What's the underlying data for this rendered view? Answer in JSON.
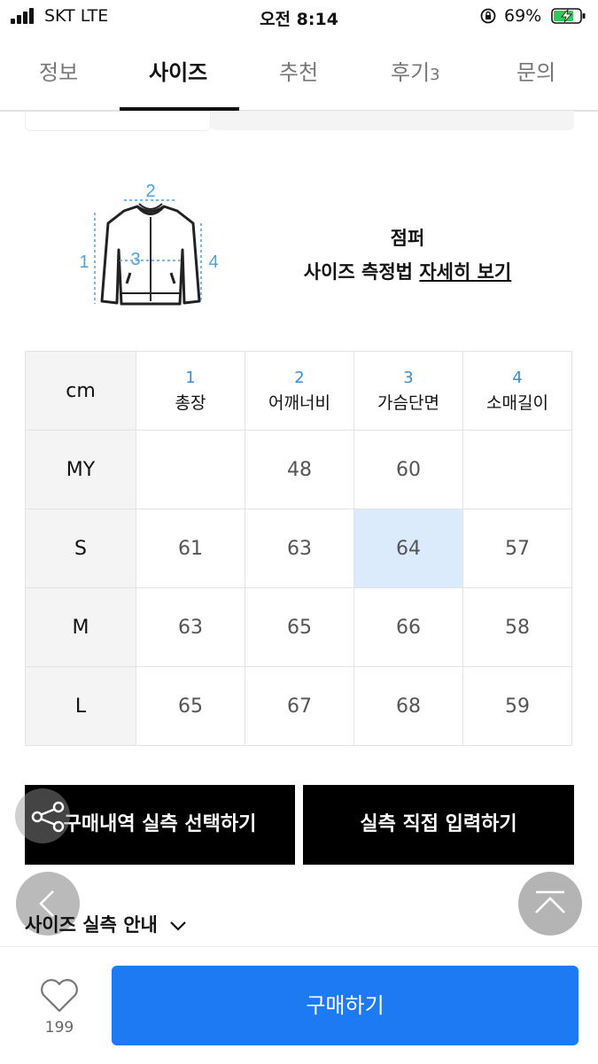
{
  "status_bar": {
    "carrier": "SKT   LTE",
    "time": "오전 8:14",
    "battery": "69%"
  },
  "tabs": [
    {
      "label": "정보"
    },
    {
      "label": "사이즈",
      "active": true
    },
    {
      "label": "추천"
    },
    {
      "label": "후기",
      "count": "3"
    },
    {
      "label": "문의"
    }
  ],
  "size_guide": {
    "icon": "jacket-measurement-icon",
    "measure_labels": [
      "1",
      "2",
      "3",
      "4"
    ],
    "category": "점퍼",
    "method_prefix": "사이즈 측정법 ",
    "method_link": "자세히 보기"
  },
  "size_table": {
    "unit": "cm",
    "columns": [
      {
        "num": "1",
        "label": "총장"
      },
      {
        "num": "2",
        "label": "어깨너비"
      },
      {
        "num": "3",
        "label": "가슴단면"
      },
      {
        "num": "4",
        "label": "소매길이"
      }
    ],
    "rows": [
      {
        "label": "MY",
        "values": [
          "",
          "48",
          "60",
          ""
        ]
      },
      {
        "label": "S",
        "values": [
          "61",
          "63",
          "64",
          "57"
        ]
      },
      {
        "label": "M",
        "values": [
          "63",
          "65",
          "66",
          "58"
        ]
      },
      {
        "label": "L",
        "values": [
          "65",
          "67",
          "68",
          "59"
        ]
      }
    ]
  },
  "actions": {
    "select_purchase": "구매내역 실측 선택하기",
    "enter_manual": "실측 직접 입력하기"
  },
  "info_toggle": "사이즈 실측 안내",
  "bottom_bar": {
    "likes": "199",
    "buy_label": "구매하기"
  },
  "colors": {
    "accent": "#1d7af3",
    "highlight_cell": "#dcebfb",
    "measure_number": "#3b8ed6"
  }
}
